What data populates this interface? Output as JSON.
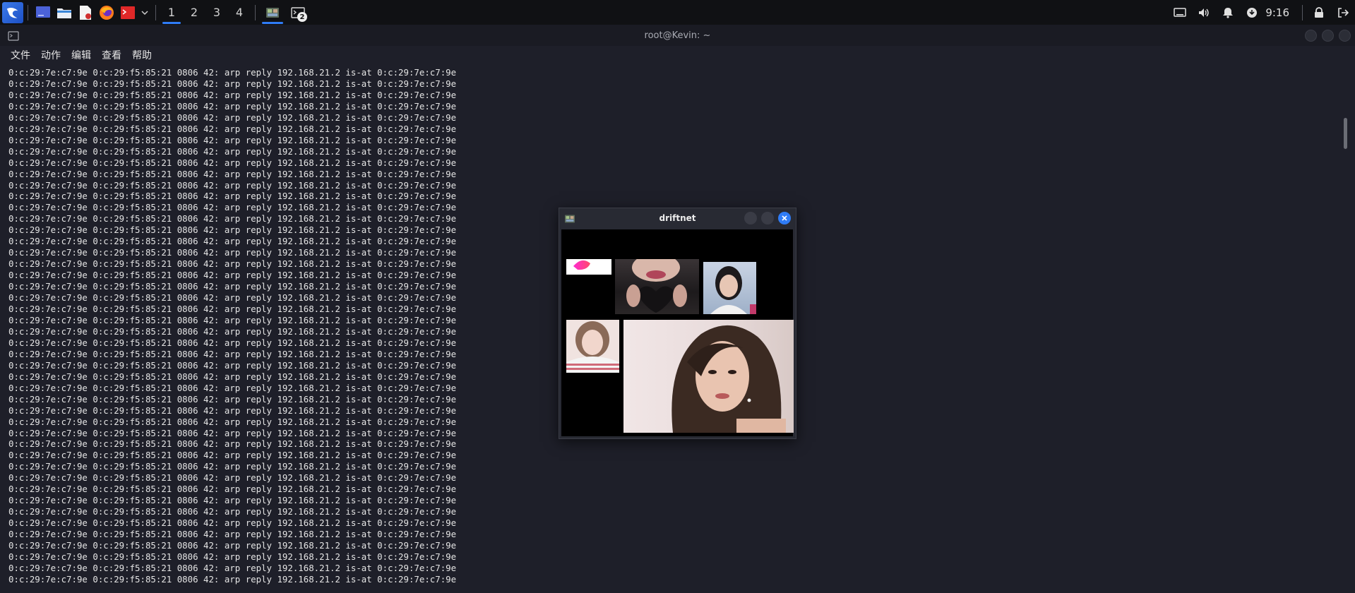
{
  "panel": {
    "workspaces": [
      "1",
      "2",
      "3",
      "4"
    ],
    "active_workspace": "1",
    "terminal_badge": "2",
    "clock": "9:16"
  },
  "terminal": {
    "title": "root@Kevin: ~",
    "menu": [
      "文件",
      "动作",
      "编辑",
      "查看",
      "帮助"
    ],
    "line_text": "0:c:29:7e:c7:9e 0:c:29:f5:85:21 0806 42: arp reply 192.168.21.2 is-at 0:c:29:7e:c7:9e",
    "line_count": 46
  },
  "driftnet": {
    "title": "driftnet"
  },
  "colors": {
    "accent": "#2f7cf6",
    "terminal_bg": "#1e1f29",
    "panel_bg": "#101114"
  }
}
